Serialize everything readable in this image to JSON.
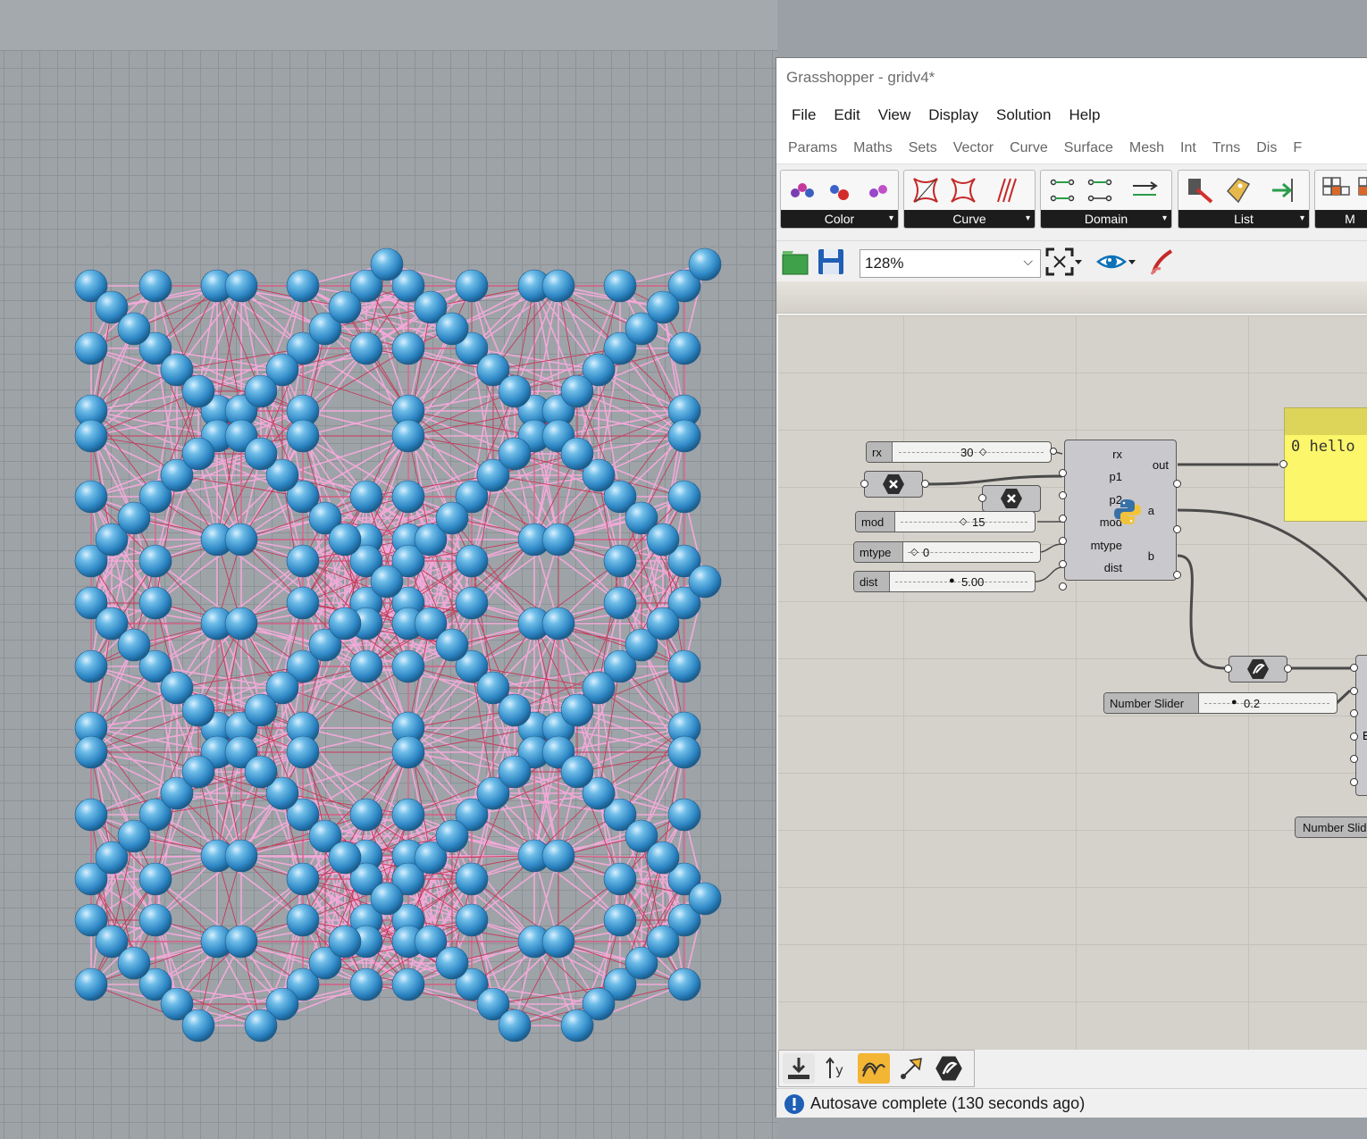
{
  "window": {
    "title": "Grasshopper - gridv4*"
  },
  "menubar": [
    "File",
    "Edit",
    "View",
    "Display",
    "Solution",
    "Help"
  ],
  "tabs": [
    "Params",
    "Maths",
    "Sets",
    "Vector",
    "Curve",
    "Surface",
    "Mesh",
    "Int",
    "Trns",
    "Dis",
    "F"
  ],
  "ribbon": {
    "groups": [
      "Color",
      "Curve",
      "Domain",
      "List",
      "M"
    ]
  },
  "toolbar": {
    "zoom": "128%"
  },
  "canvas": {
    "sliders": {
      "rx": {
        "name": "rx",
        "value": "30"
      },
      "mod": {
        "name": "mod",
        "value": "15"
      },
      "mtype": {
        "name": "mtype",
        "value": "0"
      },
      "dist": {
        "name": "dist",
        "value": "5.00"
      },
      "number_slider_1": {
        "name": "Number Slider",
        "value": "0.2"
      },
      "number_slider_2": {
        "name": "Number Slid"
      }
    },
    "python": {
      "inputs": [
        "rx",
        "p1",
        "p2",
        "mod",
        "mtype",
        "dist"
      ],
      "outputs": [
        "out",
        "a",
        "b"
      ]
    },
    "panel": {
      "text": "0 hello"
    },
    "partial_label": "E"
  },
  "status": {
    "text": "Autosave complete (130 seconds ago)"
  },
  "colors": {
    "sphere": "#4da6d9",
    "edge_pink": "#f2a9d8",
    "edge_red": "#c8385a",
    "panel_yellow": "#fcf66a"
  }
}
